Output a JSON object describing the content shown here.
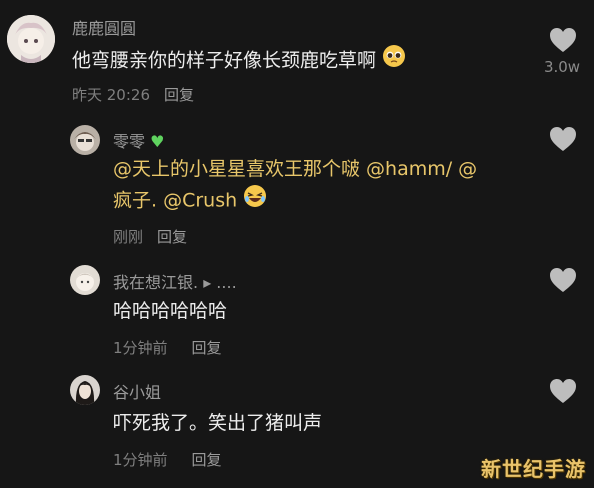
{
  "comments": [
    {
      "username": "鹿鹿圓圓",
      "text": "他弯腰亲你的样子好像长颈鹿吃草啊",
      "emoji": "pleading-face",
      "time": "昨天 20:26",
      "reply_label": "回复",
      "like_count": "3.0w"
    },
    {
      "username": "零零",
      "username_badge": "green-heart",
      "text_line1": "@天上的小星星喜欢王那个啵 @hamm/ @",
      "text_line2": "疯子. @Crush",
      "emoji": "laughing-face",
      "time": "刚刚",
      "reply_label": "回复"
    },
    {
      "username": "我在想江银.",
      "username_suffix": "▸ ....",
      "text": "哈哈哈哈哈哈",
      "time": "1分钟前",
      "reply_label": "回复"
    },
    {
      "username": "谷小姐",
      "text": "吓死我了。笑出了猪叫声",
      "time": "1分钟前",
      "reply_label": "回复"
    }
  ],
  "watermark": "新世纪手游",
  "colors": {
    "background": "#161616",
    "mention": "#e8c66a",
    "heart": "#bdbdbd",
    "watermark": "#e9c36a"
  }
}
